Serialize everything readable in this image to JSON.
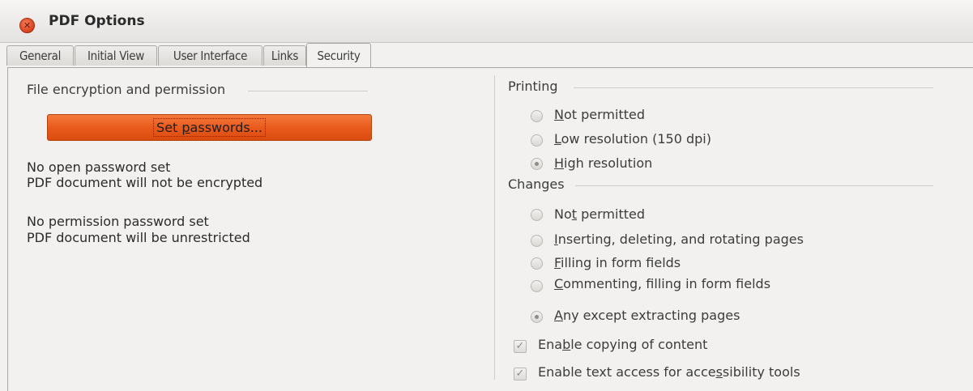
{
  "window": {
    "title": "PDF Options"
  },
  "tabs": [
    {
      "label": "General"
    },
    {
      "label": "Initial View"
    },
    {
      "label": "User Interface"
    },
    {
      "label": "Links"
    },
    {
      "label": "Security",
      "active": true
    }
  ],
  "encryption": {
    "frame_title": "File encryption and permission",
    "set_passwords_button": {
      "mnemonic_pre": "Set ",
      "mnemonic": "p",
      "mnemonic_post": "asswords..."
    },
    "open_status_1": "No open password set",
    "open_status_2": "PDF document will not be encrypted",
    "perm_status_1": "No permission password set",
    "perm_status_2": "PDF document will be unrestricted"
  },
  "printing": {
    "frame_title": "Printing",
    "options": [
      {
        "pre": "",
        "mn": "N",
        "post": "ot permitted",
        "selected": false
      },
      {
        "pre": "",
        "mn": "L",
        "post": "ow resolution (150 dpi)",
        "selected": false
      },
      {
        "pre": "",
        "mn": "H",
        "post": "igh resolution",
        "selected": true
      }
    ]
  },
  "changes": {
    "frame_title": "Changes",
    "options": [
      {
        "pre": "No",
        "mn": "t",
        "post": " permitted",
        "selected": false
      },
      {
        "pre": "",
        "mn": "I",
        "post": "nserting, deleting, and rotating pages",
        "selected": false
      },
      {
        "pre": "",
        "mn": "F",
        "post": "illing in form fields",
        "selected": false
      },
      {
        "pre": "",
        "mn": "C",
        "post": "ommenting, filling in form fields",
        "selected": false
      },
      {
        "pre": "",
        "mn": "A",
        "post": "ny except extracting pages",
        "selected": true
      }
    ]
  },
  "content": {
    "options": [
      {
        "pre": "Ena",
        "mn": "b",
        "post": "le copying of content",
        "checked": true
      },
      {
        "pre": "Enable text access for acce",
        "mn": "s",
        "post": "sibility tools",
        "checked": true
      }
    ]
  },
  "icons": {
    "close": "close-icon",
    "check": "checkmark-icon"
  },
  "colors": {
    "accent": "#e8581a",
    "close": "#d9411e"
  }
}
